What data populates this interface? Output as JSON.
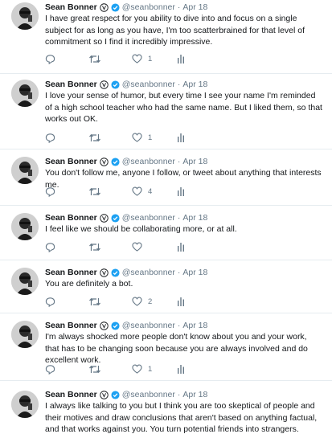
{
  "author": {
    "name": "Sean Bonner",
    "handle": "@seanbonner",
    "separator": "·",
    "verified_icon": "verified-check-icon",
    "quote_icon": "circled-v-icon"
  },
  "tweets": [
    {
      "date": "Apr 18",
      "text": "I have great respect for you ability to dive into and focus on a single subject for as long as you have, I'm too scatterbrained for that level of commitment so I find it incredibly impressive.",
      "likes": "1"
    },
    {
      "date": "Apr 18",
      "text": "I love your sense of humor, but every time I see your name I'm reminded of a high school teacher who had the same name. But I liked them, so that works out OK.",
      "likes": "1"
    },
    {
      "date": "Apr 18",
      "text": "You don't follow me, anyone I follow, or tweet about anything that interests me.",
      "likes": "4"
    },
    {
      "date": "Apr 18",
      "text": "I feel like we should be collaborating more, or at all.",
      "likes": ""
    },
    {
      "date": "Apr 18",
      "text": "You are definitely a bot.",
      "likes": "2"
    },
    {
      "date": "Apr 18",
      "text": "I'm always shocked more people don't know about you and your work, that has to be changing soon because you are always involved and do excellent work.",
      "likes": "1"
    },
    {
      "date": "Apr 18",
      "text": "I always like talking to you but I think you are too skeptical of people and their motives and draw conclusions that aren't based on anything factual, and that works against you. You turn potential friends into strangers.",
      "likes": ""
    }
  ],
  "action_icons": [
    "reply-icon",
    "retweet-icon",
    "like-icon",
    "analytics-icon"
  ],
  "colors": {
    "text": "#14171a",
    "muted": "#657786",
    "verified": "#1da1f2",
    "divider": "#e6ecf0"
  }
}
